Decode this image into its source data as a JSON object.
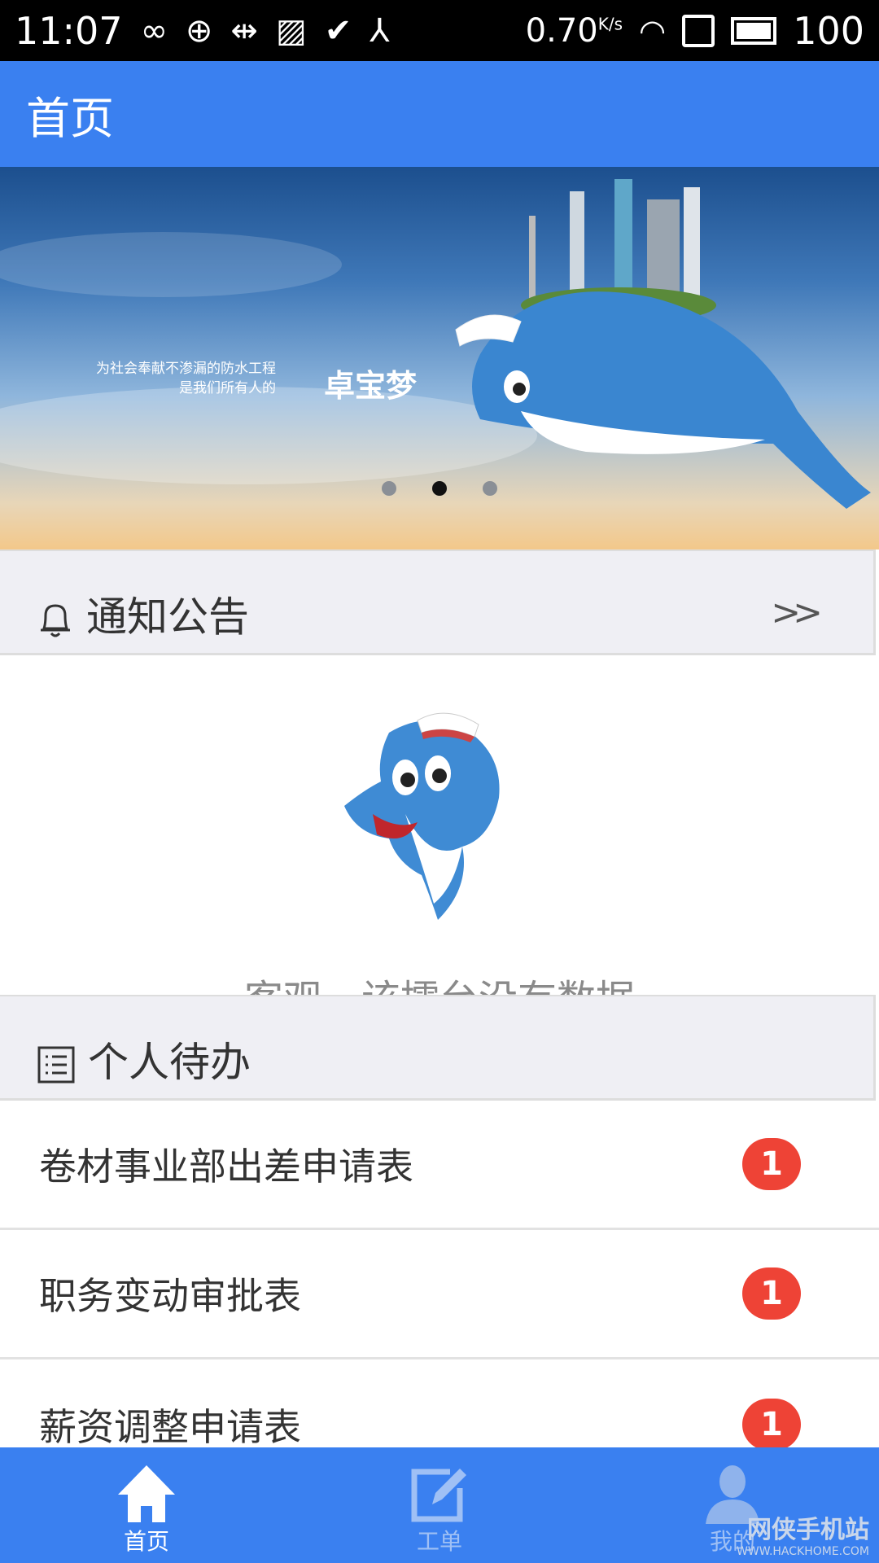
{
  "status_bar": {
    "time": "11:07",
    "net_speed": "0.70",
    "net_unit": "K/s",
    "battery": "100",
    "icons": [
      "infinity-icon",
      "sync-icon",
      "usb-icon",
      "image-icon",
      "check-icon",
      "share-icon",
      "wifi-icon",
      "sim-icon",
      "battery-icon"
    ]
  },
  "app_bar": {
    "title": "首页"
  },
  "banner": {
    "slogan_line1": "为社会奉献不渗漏的防水工程",
    "slogan_line2": "是我们所有人的",
    "brand": "卓宝梦",
    "slides": 3,
    "active_slide": 2
  },
  "notice": {
    "title": "通知公告",
    "more": ">>",
    "empty_text": "客观，该擂台没有数据"
  },
  "todo": {
    "title": "个人待办",
    "items": [
      {
        "label": "卷材事业部出差申请表",
        "count": "1"
      },
      {
        "label": "职务变动审批表",
        "count": "1"
      },
      {
        "label": "薪资调整申请表",
        "count": "1"
      }
    ]
  },
  "bottom_nav": {
    "items": [
      {
        "label": "首页",
        "active": true
      },
      {
        "label": "工单",
        "active": false
      },
      {
        "label": "我的",
        "active": false
      }
    ]
  },
  "watermark": {
    "name": "网侠手机站",
    "url": "WWW.HACKHOME.COM"
  },
  "colors": {
    "primary": "#3a80f0",
    "badge": "#ee4336",
    "section_bg": "#efeff4"
  }
}
